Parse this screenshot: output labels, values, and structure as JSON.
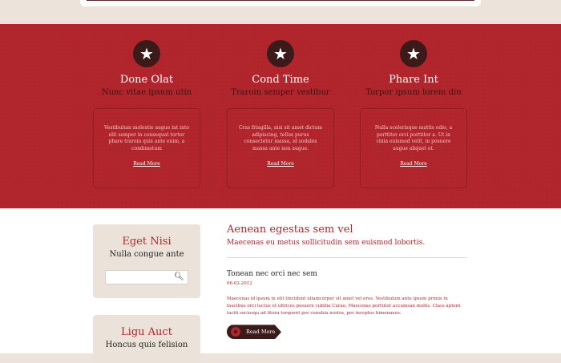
{
  "features": [
    {
      "title": "Done Olat",
      "subtitle": "Nunc vitae ipsum utin",
      "text": "Vestibulum molestie augue int into elit semper in consequat tortor phare traroin quis ante enim, a condimetum",
      "more": "Read More",
      "icon": "star-icon"
    },
    {
      "title": "Cond Time",
      "subtitle": "Traroin semper vestibur",
      "text": "Cras fringilla, nisi sit amet dictum adipiscing, tellus purus consectetur massa, id sodales massa ante non augue.",
      "more": "Read More",
      "icon": "star-icon"
    },
    {
      "title": "Phare Int",
      "subtitle": "Torpor ipsum lorem din",
      "text": "Nulla scelerisque mattis odio, a porttitor orci porttitor a. Ut in cinia euismod velit, in posuere augue aliquet et.",
      "more": "Read More",
      "icon": "star-icon"
    }
  ],
  "sidebar": {
    "search_widget": {
      "title": "Eget Nisi",
      "subtitle": "Nulla congue ante",
      "placeholder": ""
    },
    "second_widget": {
      "title": "Ligu Auct",
      "subtitle": "Honcus quis felision"
    }
  },
  "main": {
    "title": "Aenean egestas sem vel",
    "subtitle": "Maecenas eu metus sollicitudin sem euismod lobortis.",
    "post": {
      "title": "Tonean nec orci nec sem",
      "date": "06-02-2012",
      "text": "Maecenas id ipsum in elit tincidunt ullamcorper sit amet vel eros. Vestibulum ante ipsum primis in faucibus orci luctus et ultrices posuere cubilia Curae; Maecenas porttitor accumsan mollis. Class aptent taciti sociosqu ad litora torquent per conubia nostra, per inceptos himenaeos.",
      "button": "Read More"
    }
  },
  "colors": {
    "accent_red": "#b3252c",
    "dark_brown": "#3b1a1a",
    "beige": "#ebe3da"
  }
}
